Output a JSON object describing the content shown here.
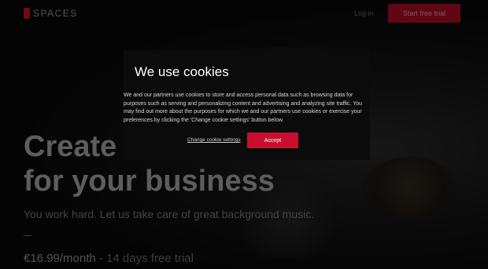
{
  "header": {
    "logo_text": "SPACES",
    "login_label": "Log in",
    "trial_button": "Start free trial"
  },
  "hero": {
    "title_line1": "Create",
    "title_line2": "for your business",
    "subtitle": "You work hard. Let us take care of great background music.",
    "price_amount": "€16.99/month",
    "price_rest": " - 14 days free trial"
  },
  "cookie_modal": {
    "title": "We use cookies",
    "body": "We and our partners use cookies to store and access personal data such as browsing data for purposes such as serving and personalizing content and advertising and analyzing site traffic. You may find out more about the purposes for which we and our partners use cookies or exercise your preferences by clicking the 'Change cookie settings' button below.",
    "change_settings": "Change cookie settings",
    "accept": "Accept"
  },
  "colors": {
    "accent": "#c8102e",
    "background": "#050505"
  }
}
